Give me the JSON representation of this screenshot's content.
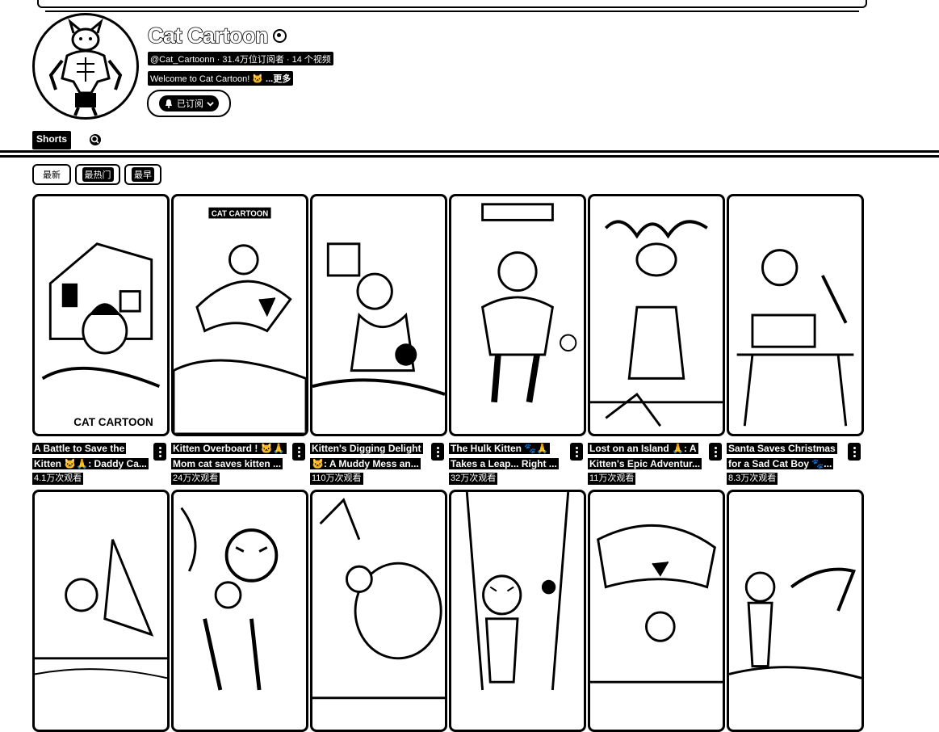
{
  "channel": {
    "name": "Cat Cartoon",
    "handle_line": "@Cat_Cartoonn · 31.4万位订阅者 · 14 个视频",
    "description": "Welcome to Cat Cartoon! 🐱",
    "more_link": "...更多",
    "subscribe_label": "已订阅",
    "avatar_icon": "cat-bodybuilder-avatar-icon"
  },
  "tabs": {
    "shorts": "Shorts",
    "search_icon": "search-icon"
  },
  "filters": [
    "最新",
    "最热门",
    "最早"
  ],
  "videos": [
    {
      "title": "A Battle to Save the Kitten 🐱🙏: Daddy Ca...",
      "views": "4.1万次观看",
      "scene": "house"
    },
    {
      "title": "Kitten Overboard ! 🐱🙏 Mom cat saves kitten ...",
      "views": "24万次观看",
      "scene": "shark",
      "overlay": "CAT CARTOON"
    },
    {
      "title": "Kitten's Digging Delight 🐱: A Muddy Mess an...",
      "views": "110万次观看",
      "scene": "digging"
    },
    {
      "title": "The Hulk Kitten 🐾🙏 Takes a Leap... Right ...",
      "views": "32万次观看",
      "scene": "hulk"
    },
    {
      "title": "Lost on an Island 🙏: A Kitten's Epic Adventur...",
      "views": "11万次观看",
      "scene": "octopus"
    },
    {
      "title": "Santa Saves Christmas for a Sad Cat Boy 🐾...",
      "views": "8.3万次观看",
      "scene": "santa"
    },
    {
      "title": "",
      "views": "",
      "scene": "shark2"
    },
    {
      "title": "",
      "views": "",
      "scene": "tiger"
    },
    {
      "title": "",
      "views": "",
      "scene": "giant"
    },
    {
      "title": "",
      "views": "",
      "scene": "street"
    },
    {
      "title": "",
      "views": "",
      "scene": "shark3"
    },
    {
      "title": "",
      "views": "",
      "scene": "croc"
    }
  ]
}
